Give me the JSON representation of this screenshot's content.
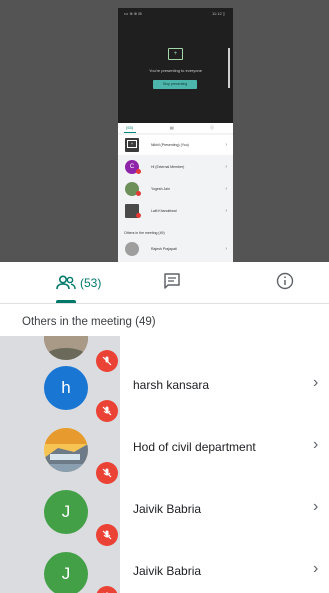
{
  "screen_preview": {
    "status_left": "••• ⊕ ⊕ ⊞",
    "status_right": "11:12 ▯",
    "presenting_text": "You're presenting to everyone",
    "stop_button": "Stop presenting",
    "tab_people": "(53)",
    "you_label": "Nikhil (Presenting) (You)",
    "row_labels": [
      "Hi (External Member)",
      "Yogesh Jain",
      "Lalit Khandelwal"
    ],
    "section": "Others in the meeting (49)",
    "last_label": "Rajesh Prajapati"
  },
  "tabs": {
    "people_count": "(53)",
    "people_icon": "people-icon",
    "chat_icon": "chat-icon",
    "info_icon": "info-icon",
    "accent_color": "#00796b"
  },
  "section_header": "Others in the meeting (49)",
  "participants": [
    {
      "name": "",
      "initial": "",
      "avatar": "photo-partial"
    },
    {
      "name": "harsh kansara",
      "initial": "h",
      "avatar": "#1976d2"
    },
    {
      "name": "Hod of civil department",
      "initial": "",
      "avatar": "photo-building"
    },
    {
      "name": "Jaivik Babria",
      "initial": "J",
      "avatar": "#43a047"
    },
    {
      "name": "Jaivik Babria",
      "initial": "J",
      "avatar": "#43a047"
    }
  ],
  "mute_color": "#ea4335"
}
